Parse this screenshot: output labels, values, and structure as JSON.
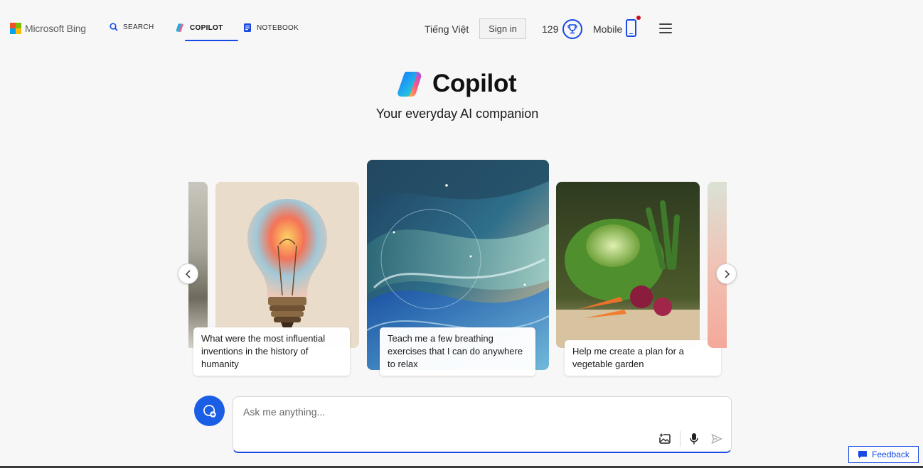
{
  "header": {
    "brand": "Microsoft Bing",
    "nav": [
      {
        "label": "SEARCH",
        "icon": "search-icon"
      },
      {
        "label": "COPILOT",
        "icon": "copilot-icon",
        "active": true
      },
      {
        "label": "NOTEBOOK",
        "icon": "notebook-icon"
      }
    ],
    "language": "Tiếng Việt",
    "sign_in": "Sign in",
    "points": "129",
    "mobile": "Mobile"
  },
  "hero": {
    "title": "Copilot",
    "subtitle": "Your everyday AI companion"
  },
  "carousel": {
    "cards": [
      {
        "caption": "What were the most influential inventions in the history of humanity",
        "image": "lightbulb"
      },
      {
        "caption": "Teach me a few breathing exercises that I can do anywhere to relax",
        "image": "abstract-waves"
      },
      {
        "caption": "Help me create a plan for a vegetable garden",
        "image": "vegetables"
      }
    ]
  },
  "composer": {
    "placeholder": "Ask me anything..."
  },
  "feedback": "Feedback",
  "colors": {
    "accent": "#174ae4",
    "chat_button": "#1b5ee6",
    "notification": "#c50f1f"
  }
}
